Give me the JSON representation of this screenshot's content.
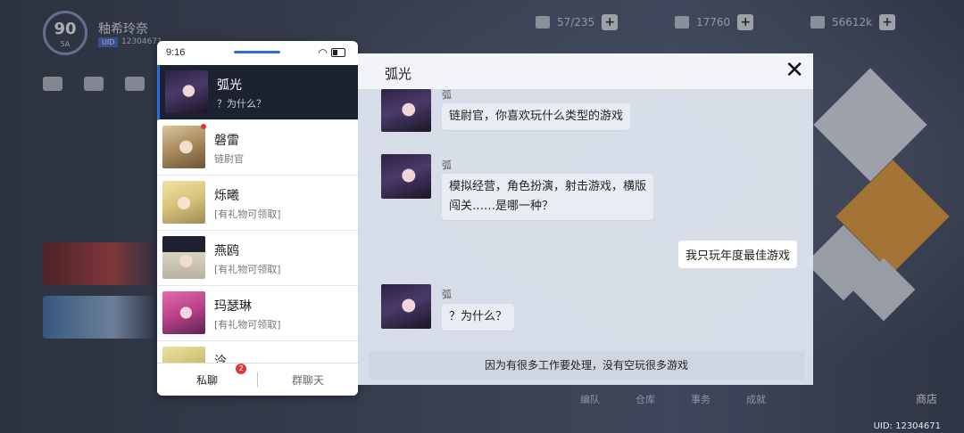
{
  "hud": {
    "level": "90",
    "level_sub": "5A",
    "player_name": "釉希玲奈",
    "player_tag": "UID",
    "player_id": "12304671",
    "resources": [
      {
        "value": "57/235"
      },
      {
        "value": "17760"
      },
      {
        "value": "56612k"
      }
    ],
    "uid_label": "UID: 12304671",
    "bottom_items": [
      "编队",
      "仓库",
      "事务",
      "成就"
    ],
    "shop_label": "商店"
  },
  "phone": {
    "time": "9:16",
    "contacts": [
      {
        "name": "弧光",
        "sub": "？为什么？",
        "active": true
      },
      {
        "name": "磐雷",
        "sub": "链尉官",
        "notify": true
      },
      {
        "name": "烁曦",
        "sub": "[有礼物可领取]"
      },
      {
        "name": "燕鸥",
        "sub": "[有礼物可领取]"
      },
      {
        "name": "玛瑟琳",
        "sub": "[有礼物可领取]"
      },
      {
        "name": "泠",
        "sub": ""
      }
    ],
    "tabs": {
      "private": "私聊",
      "private_badge": "2",
      "group": "群聊天"
    }
  },
  "chat": {
    "title": "弧光",
    "messages": [
      {
        "speaker": "弧光",
        "text": "链尉官，你喜欢玩什么类型的游戏"
      },
      {
        "speaker": "弧光",
        "text_line1": "模拟经营，角色扮演，射击游戏，横版",
        "text_line2": "闯关……是哪一种？"
      },
      {
        "me": true,
        "text": "我只玩年度最佳游戏"
      },
      {
        "speaker": "弧光",
        "text": "？为什么？"
      }
    ],
    "reply_option": "因为有很多工作要处理，没有空玩很多游戏",
    "close_glyph": "✕"
  }
}
